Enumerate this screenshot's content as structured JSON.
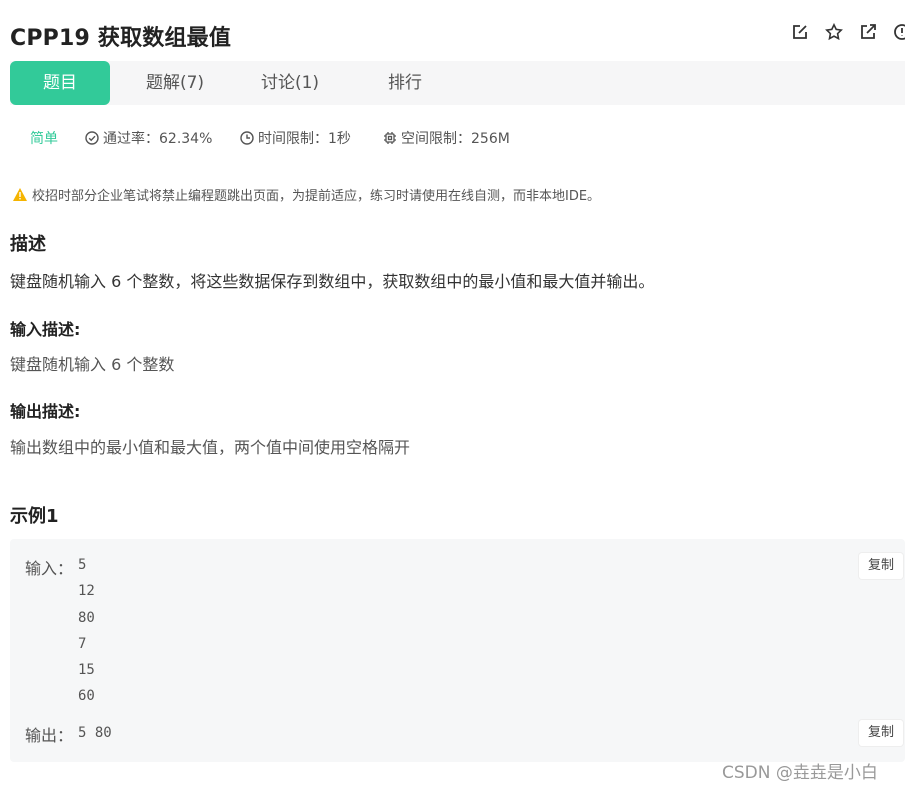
{
  "problem": {
    "title": "CPP19  获取数组最值"
  },
  "header_icons": [
    "edit-icon",
    "star-icon",
    "share-icon",
    "info-icon"
  ],
  "tabs": [
    {
      "label": "题目",
      "active": true
    },
    {
      "label": "题解(7)",
      "active": false
    },
    {
      "label": "讨论(1)",
      "active": false
    },
    {
      "label": "排行",
      "active": false
    }
  ],
  "meta": {
    "level": "简单",
    "pass_rate": "通过率：62.34%",
    "time_limit": "时间限制：1秒",
    "space_limit": "空间限制：256M"
  },
  "warning": "校招时部分企业笔试将禁止编程题跳出页面，为提前适应，练习时请使用在线自测，而非本地IDE。",
  "description": {
    "heading": "描述",
    "text": "键盘随机输入 6 个整数，将这些数据保存到数组中，获取数组中的最小值和最大值并输出。"
  },
  "input_desc": {
    "heading": "输入描述:",
    "text": "键盘随机输入 6 个整数"
  },
  "output_desc": {
    "heading": "输出描述:",
    "text": "输出数组中的最小值和最大值，两个值中间使用空格隔开"
  },
  "example": {
    "heading": "示例1",
    "input_label": "输入：",
    "input_values": [
      "5",
      "12",
      "80",
      "7",
      "15",
      "60"
    ],
    "output_label": "输出：",
    "output_value": "5 80",
    "copy_label": "复制"
  },
  "watermark": "CSDN @垚垚是小白",
  "colors": {
    "accent": "#32ca99",
    "warning": "#f5b400"
  }
}
